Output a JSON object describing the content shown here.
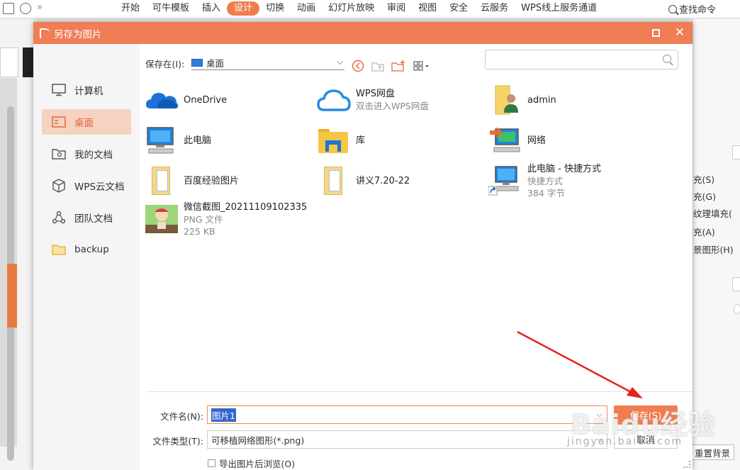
{
  "ribbon": {
    "menu": [
      "开始",
      "可牛模板",
      "插入",
      "设计",
      "切换",
      "动画",
      "幻灯片放映",
      "审阅",
      "视图",
      "安全",
      "云服务",
      "WPS线上服务通道"
    ],
    "active_menu": "设计",
    "find_command": "查找命令"
  },
  "right_panel": {
    "items": [
      "充(S)",
      "充(G)",
      "纹理填充(",
      "充(A)",
      "景图形(H)"
    ],
    "reset_button": "重置背景"
  },
  "dialog": {
    "title": "另存为图片",
    "accent_color": "#f07d56",
    "sidebar": [
      {
        "label": "计算机",
        "icon": "monitor-icon"
      },
      {
        "label": "桌面",
        "icon": "desktop-icon",
        "selected": true
      },
      {
        "label": "我的文档",
        "icon": "my-documents-icon"
      },
      {
        "label": "WPS云文档",
        "icon": "cloud-docs-icon"
      },
      {
        "label": "团队文档",
        "icon": "team-docs-icon"
      },
      {
        "label": "backup",
        "icon": "folder-icon"
      }
    ],
    "save_in_label": "保存在(I):",
    "save_in_value": "桌面",
    "search_placeholder": "",
    "files": [
      {
        "name": "OneDrive",
        "sub": "",
        "sub2": "",
        "icon": "onedrive-icon"
      },
      {
        "name": "WPS网盘",
        "sub": "双击进入WPS网盘",
        "sub2": "",
        "icon": "wps-cloud-icon"
      },
      {
        "name": "admin",
        "sub": "",
        "sub2": "",
        "icon": "user-folder-icon"
      },
      {
        "name": "此电脑",
        "sub": "",
        "sub2": "",
        "icon": "computer-icon"
      },
      {
        "name": "库",
        "sub": "",
        "sub2": "",
        "icon": "library-icon"
      },
      {
        "name": "网络",
        "sub": "",
        "sub2": "",
        "icon": "network-icon"
      },
      {
        "name": "百度经验图片",
        "sub": "",
        "sub2": "",
        "icon": "image-folder-icon"
      },
      {
        "name": "讲义7.20-22",
        "sub": "",
        "sub2": "",
        "icon": "doc-folder-icon"
      },
      {
        "name": "此电脑 - 快捷方式",
        "sub": "快捷方式",
        "sub2": "384 字节",
        "icon": "computer-shortcut-icon"
      },
      {
        "name": "微信截图_20211109102335",
        "sub": "PNG 文件",
        "sub2": "225 KB",
        "icon": "image-thumbnail-icon"
      }
    ],
    "filename_label": "文件名(N):",
    "filename_value": "图片1",
    "filetype_label": "文件类型(T):",
    "filetype_value": "可移植网络图形(*.png)",
    "save_button": "保存(S)",
    "cancel_button": "取消",
    "browse_checkbox": "导出图片后浏览(O)"
  },
  "watermark": {
    "main": "Baidu经验",
    "sub": "jingyan.baidu.com"
  }
}
